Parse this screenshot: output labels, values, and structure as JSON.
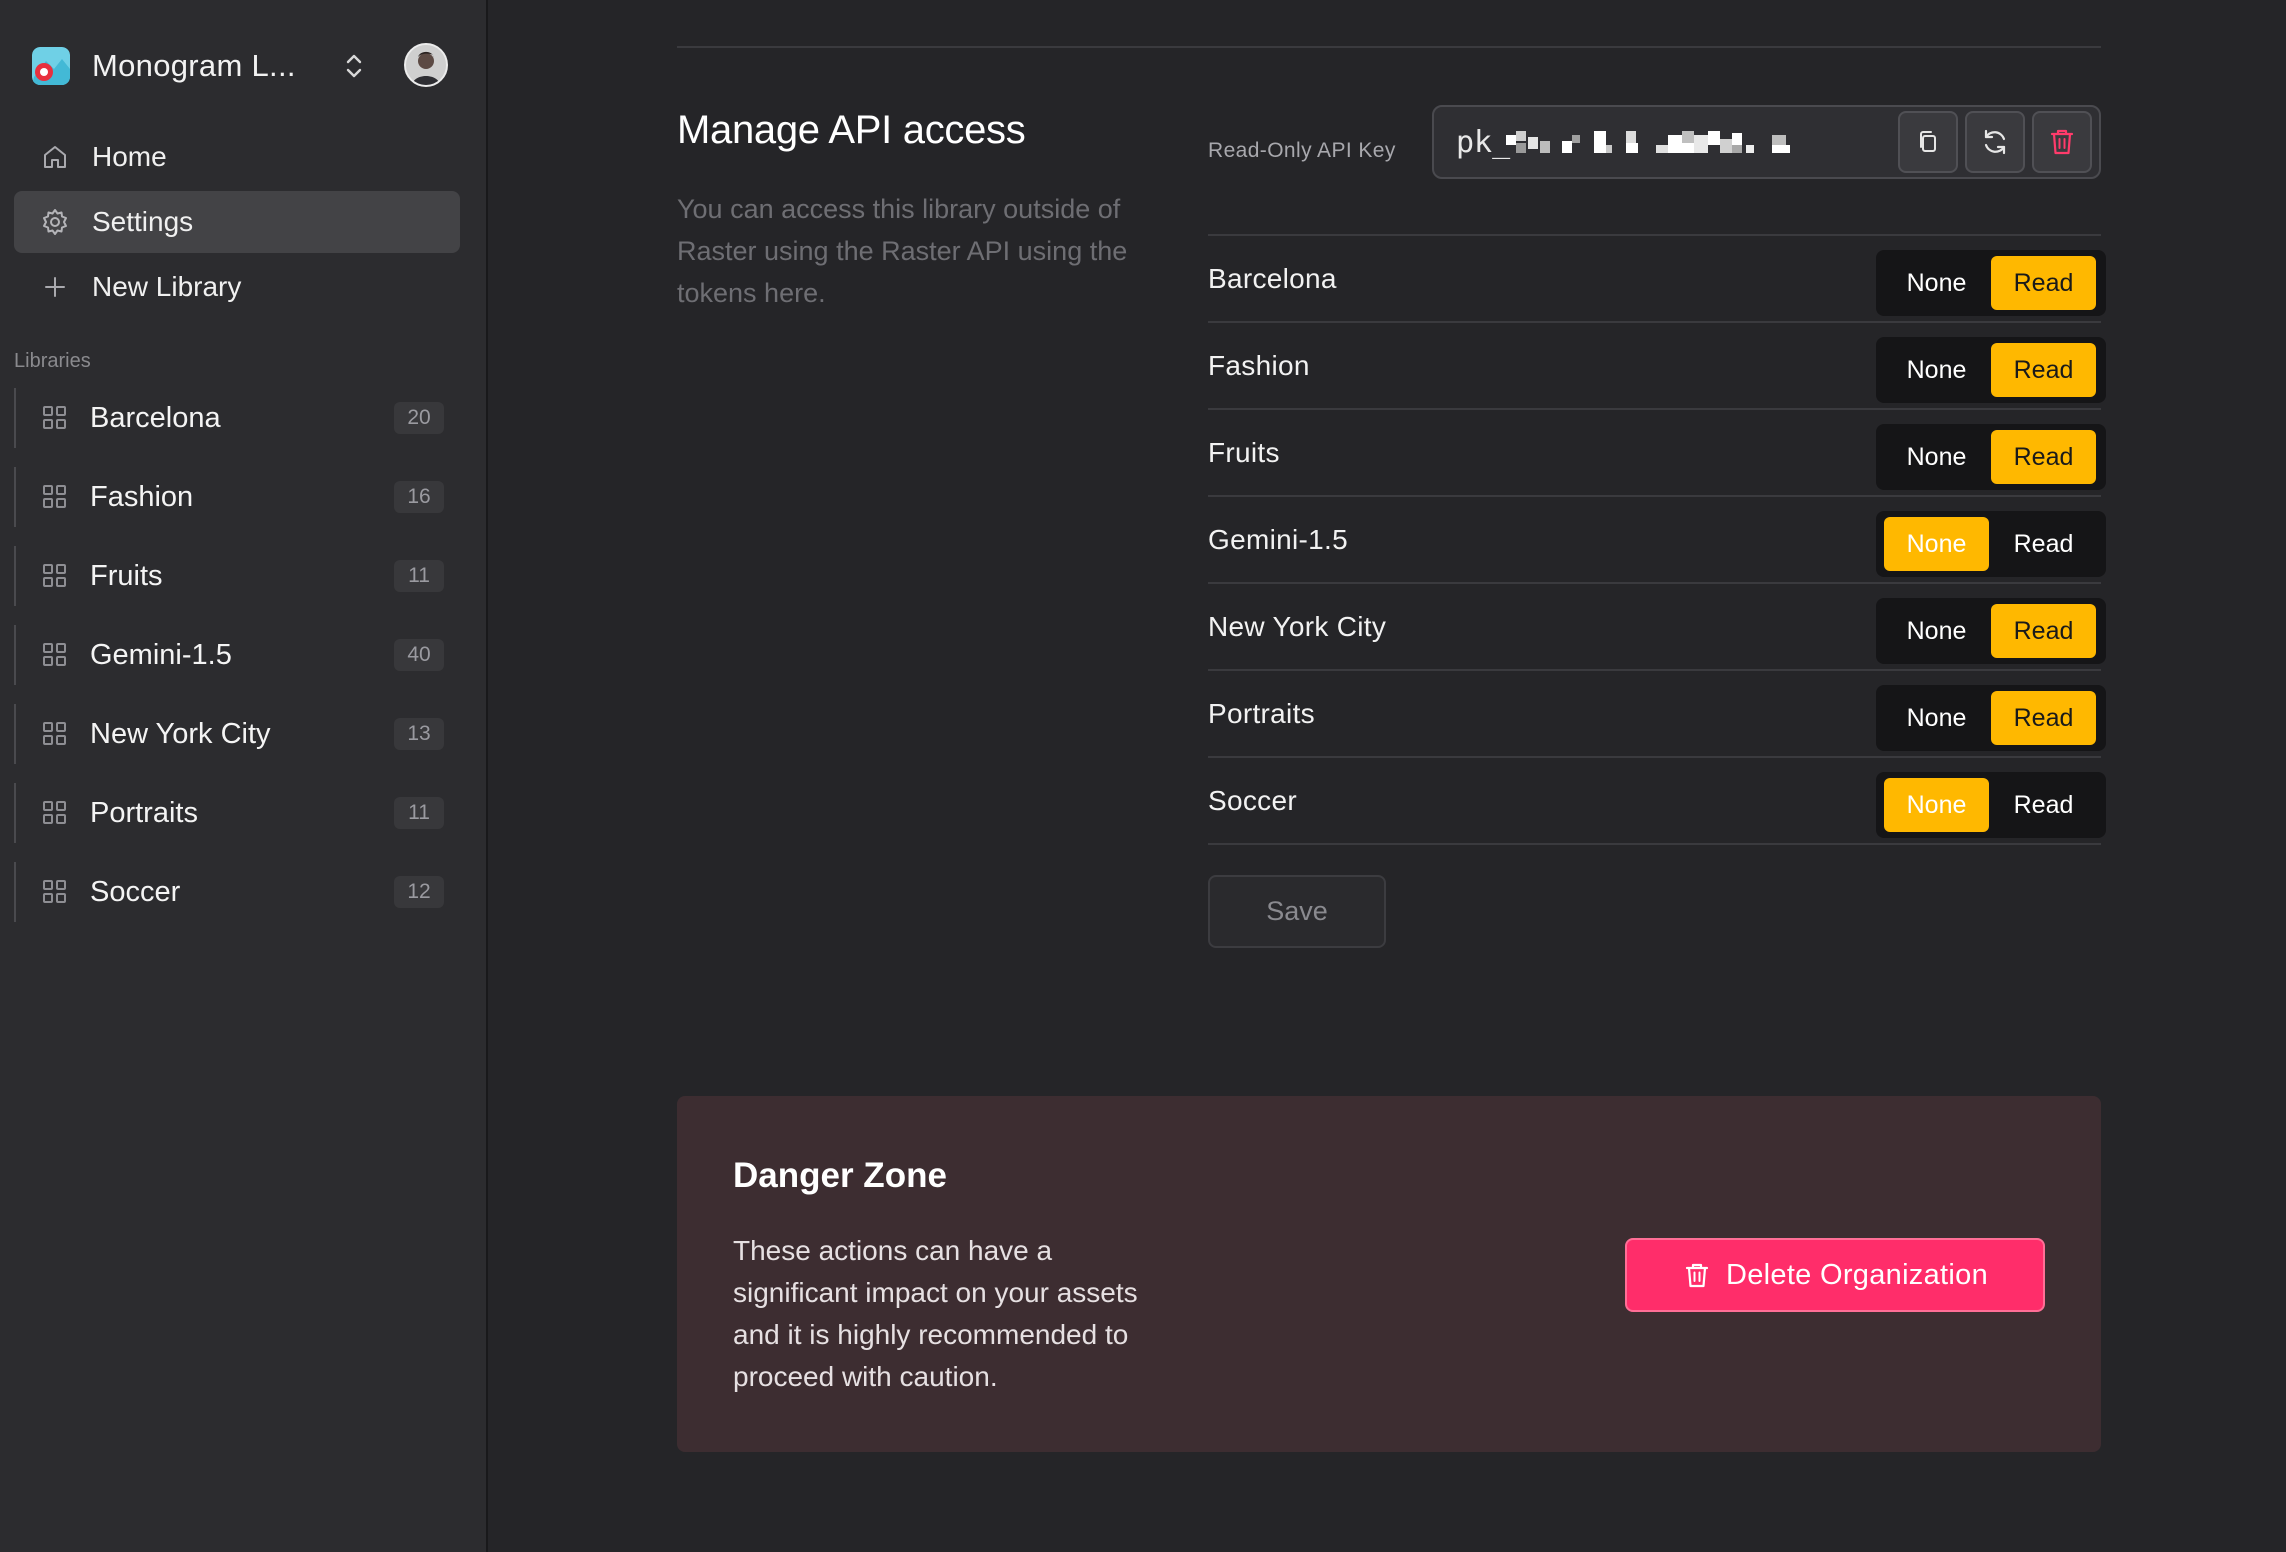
{
  "org": {
    "name": "Monogram L...",
    "logo_icon": "app-logo-icon",
    "switch_icon": "chevron-up-down-icon"
  },
  "nav": [
    {
      "label": "Home",
      "icon": "home-icon"
    },
    {
      "label": "Settings",
      "icon": "gear-icon",
      "active": true
    },
    {
      "label": "New Library",
      "icon": "plus-icon"
    }
  ],
  "libraries_heading": "Libraries",
  "libraries": [
    {
      "name": "Barcelona",
      "count": "20"
    },
    {
      "name": "Fashion",
      "count": "16"
    },
    {
      "name": "Fruits",
      "count": "11"
    },
    {
      "name": "Gemini-1.5",
      "count": "40"
    },
    {
      "name": "New York City",
      "count": "13"
    },
    {
      "name": "Portraits",
      "count": "11"
    },
    {
      "name": "Soccer",
      "count": "12"
    }
  ],
  "api": {
    "title": "Manage API access",
    "description": "You can access this library outside of Raster using the Raster API using the tokens here.",
    "key_label": "Read-Only API Key",
    "key_prefix": "pk_",
    "buttons": [
      "copy-icon",
      "refresh-icon",
      "trash-icon"
    ]
  },
  "permissions": {
    "options": [
      "None",
      "Read"
    ],
    "rows": [
      {
        "name": "Barcelona",
        "selected": "Read"
      },
      {
        "name": "Fashion",
        "selected": "Read"
      },
      {
        "name": "Fruits",
        "selected": "Read"
      },
      {
        "name": "Gemini-1.5",
        "selected": "None"
      },
      {
        "name": "New York City",
        "selected": "Read"
      },
      {
        "name": "Portraits",
        "selected": "Read"
      },
      {
        "name": "Soccer",
        "selected": "None"
      }
    ]
  },
  "save_label": "Save",
  "danger": {
    "title": "Danger Zone",
    "description": "These actions can have a significant impact on your assets and it is highly recommended to proceed with caution.",
    "delete_label": "Delete Organization"
  },
  "colors": {
    "accent": "#ffb800",
    "danger_button": "#ff2d6a",
    "danger_bg": "#3d2d31",
    "sidebar_bg": "#2c2c2f",
    "main_bg": "#252528"
  }
}
